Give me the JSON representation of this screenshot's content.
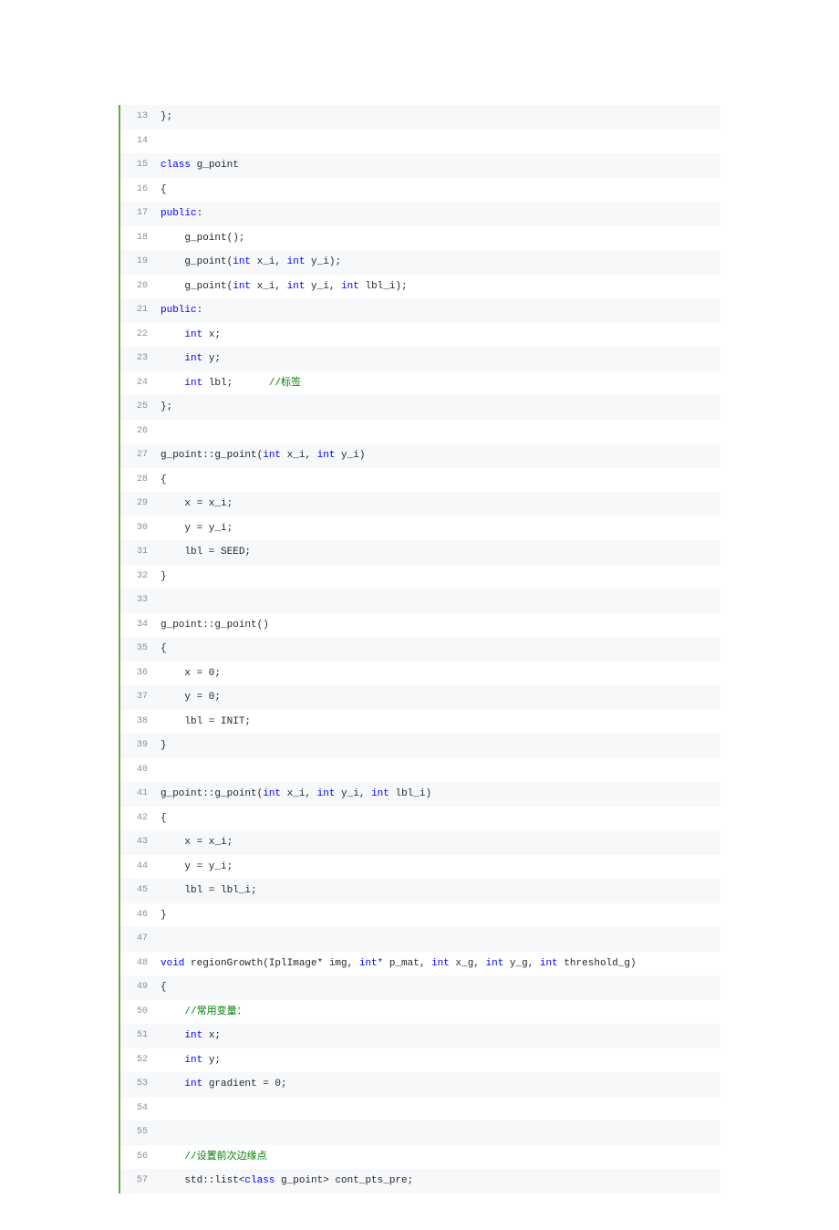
{
  "code": {
    "start": 13,
    "lines": [
      {
        "n": 13,
        "tokens": [
          {
            "t": "};",
            "c": ""
          }
        ]
      },
      {
        "n": 14,
        "tokens": []
      },
      {
        "n": 15,
        "tokens": [
          {
            "t": "class",
            "c": "kw"
          },
          {
            "t": " g_point",
            "c": ""
          }
        ]
      },
      {
        "n": 16,
        "tokens": [
          {
            "t": "{",
            "c": ""
          }
        ]
      },
      {
        "n": 17,
        "tokens": [
          {
            "t": "public",
            "c": "kw"
          },
          {
            "t": ":",
            "c": ""
          }
        ]
      },
      {
        "n": 18,
        "tokens": [
          {
            "t": "    g_point();",
            "c": ""
          }
        ]
      },
      {
        "n": 19,
        "tokens": [
          {
            "t": "    g_point(",
            "c": ""
          },
          {
            "t": "int",
            "c": "kw"
          },
          {
            "t": " x_i, ",
            "c": ""
          },
          {
            "t": "int",
            "c": "kw"
          },
          {
            "t": " y_i);",
            "c": ""
          }
        ]
      },
      {
        "n": 20,
        "tokens": [
          {
            "t": "    g_point(",
            "c": ""
          },
          {
            "t": "int",
            "c": "kw"
          },
          {
            "t": " x_i, ",
            "c": ""
          },
          {
            "t": "int",
            "c": "kw"
          },
          {
            "t": " y_i, ",
            "c": ""
          },
          {
            "t": "int",
            "c": "kw"
          },
          {
            "t": " lbl_i);",
            "c": ""
          }
        ]
      },
      {
        "n": 21,
        "tokens": [
          {
            "t": "public",
            "c": "kw"
          },
          {
            "t": ":",
            "c": ""
          }
        ]
      },
      {
        "n": 22,
        "tokens": [
          {
            "t": "    ",
            "c": ""
          },
          {
            "t": "int",
            "c": "kw"
          },
          {
            "t": " x;",
            "c": ""
          }
        ]
      },
      {
        "n": 23,
        "tokens": [
          {
            "t": "    ",
            "c": ""
          },
          {
            "t": "int",
            "c": "kw"
          },
          {
            "t": " y;",
            "c": ""
          }
        ]
      },
      {
        "n": 24,
        "tokens": [
          {
            "t": "    ",
            "c": ""
          },
          {
            "t": "int",
            "c": "kw"
          },
          {
            "t": " lbl;      ",
            "c": ""
          },
          {
            "t": "//标签",
            "c": "cm"
          }
        ]
      },
      {
        "n": 25,
        "tokens": [
          {
            "t": "};",
            "c": ""
          }
        ]
      },
      {
        "n": 26,
        "tokens": []
      },
      {
        "n": 27,
        "tokens": [
          {
            "t": "g_point::g_point(",
            "c": ""
          },
          {
            "t": "int",
            "c": "kw"
          },
          {
            "t": " x_i, ",
            "c": ""
          },
          {
            "t": "int",
            "c": "kw"
          },
          {
            "t": " y_i)",
            "c": ""
          }
        ]
      },
      {
        "n": 28,
        "tokens": [
          {
            "t": "{",
            "c": ""
          }
        ]
      },
      {
        "n": 29,
        "tokens": [
          {
            "t": "    x = x_i;",
            "c": ""
          }
        ]
      },
      {
        "n": 30,
        "tokens": [
          {
            "t": "    y = y_i;",
            "c": ""
          }
        ]
      },
      {
        "n": 31,
        "tokens": [
          {
            "t": "    lbl = SEED;",
            "c": ""
          }
        ]
      },
      {
        "n": 32,
        "tokens": [
          {
            "t": "}",
            "c": ""
          }
        ]
      },
      {
        "n": 33,
        "tokens": []
      },
      {
        "n": 34,
        "tokens": [
          {
            "t": "g_point::g_point()",
            "c": ""
          }
        ]
      },
      {
        "n": 35,
        "tokens": [
          {
            "t": "{",
            "c": ""
          }
        ]
      },
      {
        "n": 36,
        "tokens": [
          {
            "t": "    x = 0;",
            "c": ""
          }
        ]
      },
      {
        "n": 37,
        "tokens": [
          {
            "t": "    y = 0;",
            "c": ""
          }
        ]
      },
      {
        "n": 38,
        "tokens": [
          {
            "t": "    lbl = INIT;",
            "c": ""
          }
        ]
      },
      {
        "n": 39,
        "tokens": [
          {
            "t": "}",
            "c": ""
          }
        ]
      },
      {
        "n": 40,
        "tokens": []
      },
      {
        "n": 41,
        "tokens": [
          {
            "t": "g_point::g_point(",
            "c": ""
          },
          {
            "t": "int",
            "c": "kw"
          },
          {
            "t": " x_i, ",
            "c": ""
          },
          {
            "t": "int",
            "c": "kw"
          },
          {
            "t": " y_i, ",
            "c": ""
          },
          {
            "t": "int",
            "c": "kw"
          },
          {
            "t": " lbl_i)",
            "c": ""
          }
        ]
      },
      {
        "n": 42,
        "tokens": [
          {
            "t": "{",
            "c": ""
          }
        ]
      },
      {
        "n": 43,
        "tokens": [
          {
            "t": "    x = x_i;",
            "c": ""
          }
        ]
      },
      {
        "n": 44,
        "tokens": [
          {
            "t": "    y = y_i;",
            "c": ""
          }
        ]
      },
      {
        "n": 45,
        "tokens": [
          {
            "t": "    lbl = lbl_i;",
            "c": ""
          }
        ]
      },
      {
        "n": 46,
        "tokens": [
          {
            "t": "}",
            "c": ""
          }
        ]
      },
      {
        "n": 47,
        "tokens": []
      },
      {
        "n": 48,
        "tokens": [
          {
            "t": "void",
            "c": "kw"
          },
          {
            "t": " regionGrowth(IplImage* img, ",
            "c": ""
          },
          {
            "t": "int",
            "c": "kw"
          },
          {
            "t": "* p_mat, ",
            "c": ""
          },
          {
            "t": "int",
            "c": "kw"
          },
          {
            "t": " x_g, ",
            "c": ""
          },
          {
            "t": "int",
            "c": "kw"
          },
          {
            "t": " y_g, ",
            "c": ""
          },
          {
            "t": "int",
            "c": "kw"
          },
          {
            "t": " threshold_g)",
            "c": ""
          }
        ]
      },
      {
        "n": 49,
        "tokens": [
          {
            "t": "{",
            "c": ""
          }
        ]
      },
      {
        "n": 50,
        "tokens": [
          {
            "t": "    ",
            "c": ""
          },
          {
            "t": "//常用变量：",
            "c": "cm"
          }
        ]
      },
      {
        "n": 51,
        "tokens": [
          {
            "t": "    ",
            "c": ""
          },
          {
            "t": "int",
            "c": "kw"
          },
          {
            "t": " x;",
            "c": ""
          }
        ]
      },
      {
        "n": 52,
        "tokens": [
          {
            "t": "    ",
            "c": ""
          },
          {
            "t": "int",
            "c": "kw"
          },
          {
            "t": " y;",
            "c": ""
          }
        ]
      },
      {
        "n": 53,
        "tokens": [
          {
            "t": "    ",
            "c": ""
          },
          {
            "t": "int",
            "c": "kw"
          },
          {
            "t": " gradient = 0;",
            "c": ""
          }
        ]
      },
      {
        "n": 54,
        "tokens": []
      },
      {
        "n": 55,
        "tokens": []
      },
      {
        "n": 56,
        "tokens": [
          {
            "t": "    ",
            "c": ""
          },
          {
            "t": "//设置前次边缘点",
            "c": "cm"
          }
        ]
      },
      {
        "n": 57,
        "tokens": [
          {
            "t": "    std::list<",
            "c": ""
          },
          {
            "t": "class",
            "c": "kw"
          },
          {
            "t": " g_point> cont_pts_pre;",
            "c": ""
          }
        ]
      }
    ]
  }
}
